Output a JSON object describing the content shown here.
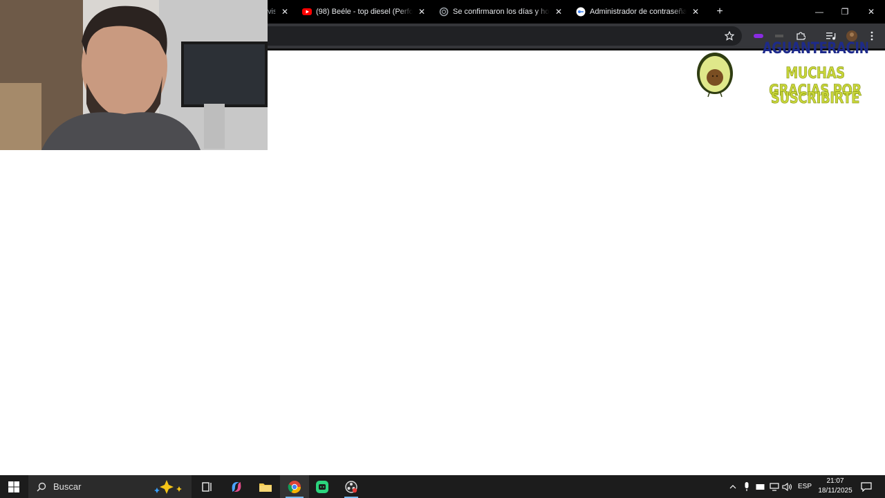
{
  "browser": {
    "tabs": [
      {
        "title": "vis",
        "favicon": "partial-tab-icon"
      },
      {
        "title": "(98) Beéle - top diesel (Performa",
        "favicon": "youtube-icon"
      },
      {
        "title": "Se confirmaron los días y horar",
        "favicon": "loading-spinner-icon"
      },
      {
        "title": "Administrador de contraseñas d",
        "favicon": "google-password-icon"
      }
    ],
    "new_tab_label": "+",
    "window_controls": {
      "minimize": "—",
      "maximize": "❐",
      "close": "✕"
    }
  },
  "overlay": {
    "username": "AGUANTERACING1994",
    "message_line1": "MUCHAS GRACIAS POR",
    "message_line2": "SUSCRIBIRTE"
  },
  "taskbar": {
    "search_placeholder": "Buscar",
    "language": "ESP",
    "time": "21:07",
    "date": "18/11/2025"
  },
  "colors": {
    "tab_strip": "#000000",
    "toolbar": "#35363a",
    "taskbar": "#1c1c1c",
    "overlay_user": "#1d2a8a",
    "overlay_message": "#c9d63a"
  }
}
